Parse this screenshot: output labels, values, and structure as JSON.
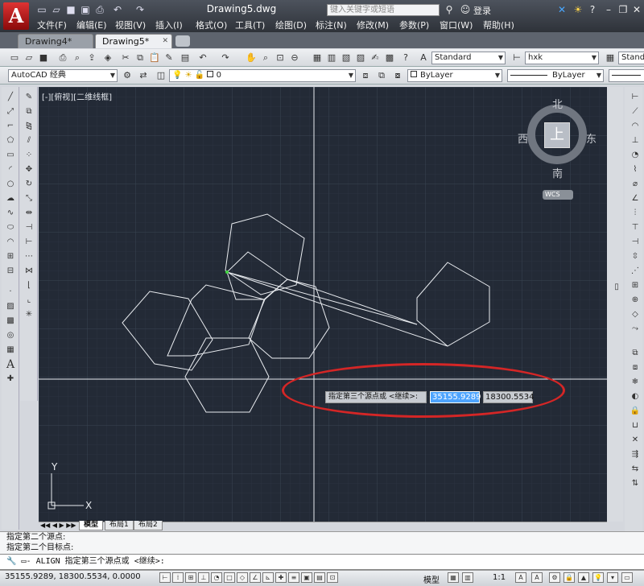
{
  "window": {
    "title": "Drawing5.dwg",
    "search_placeholder": "键入关键字或短语",
    "login": "登录"
  },
  "menu": [
    "文件(F)",
    "编辑(E)",
    "视图(V)",
    "插入(I)",
    "格式(O)",
    "工具(T)",
    "绘图(D)",
    "标注(N)",
    "修改(M)",
    "参数(P)",
    "窗口(W)",
    "帮助(H)"
  ],
  "tabs": [
    {
      "label": "Drawing4*"
    },
    {
      "label": "Drawing5*"
    }
  ],
  "toolbar": {
    "text_style": "Standard",
    "dim_style": "hxk",
    "table_style": "Stand",
    "workspace": "AutoCAD 经典",
    "layer": "0",
    "color": "ByLayer",
    "linetype": "ByLayer"
  },
  "viewport": {
    "label": "[-][俯视][二维线框]",
    "compass": {
      "north": "北",
      "south": "南",
      "east": "东",
      "west": "西",
      "top": "上"
    },
    "wcs": "WCS",
    "ucs_x": "X",
    "ucs_y": "Y"
  },
  "dynamic_input": {
    "prompt": "指定第三个源点或 <继续>:",
    "x_value": "35155.9289",
    "y_value": "18300.5534"
  },
  "layout_tabs": [
    "模型",
    "布局1",
    "布局2"
  ],
  "command_history": [
    "指定第二个源点:",
    "指定第二个目标点:"
  ],
  "command_line": "ALIGN 指定第三个源点或 <继续>:",
  "status": {
    "coordinates": "35155.9289, 18300.5534, 0.0000",
    "model": "模型",
    "scale": "1:1"
  },
  "colors": {
    "canvas": "#232a36",
    "highlight": "#d42626",
    "accent": "#4ea4ff"
  }
}
